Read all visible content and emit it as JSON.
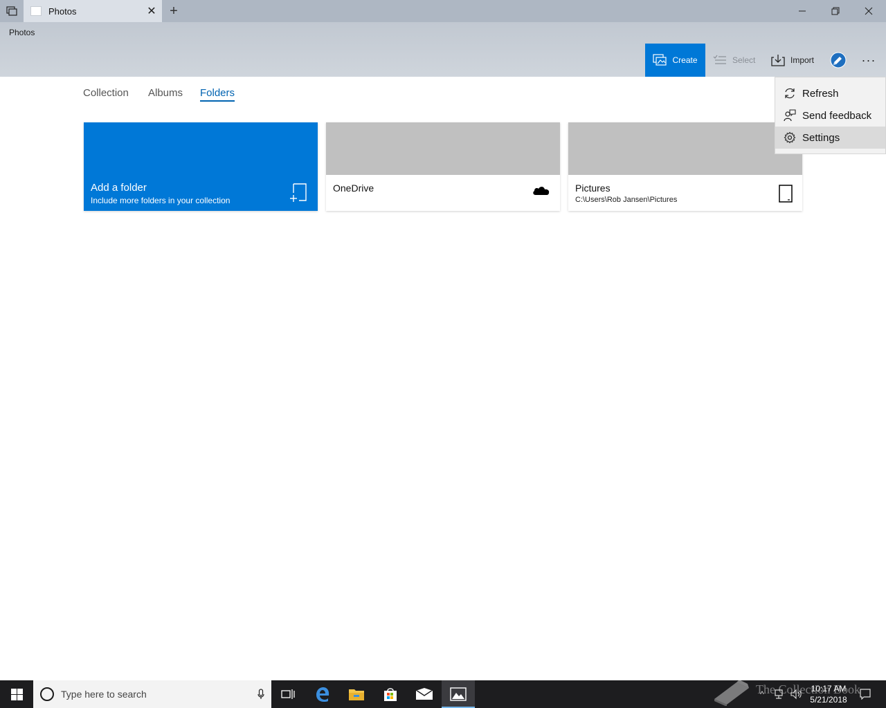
{
  "window": {
    "tab_title": "Photos",
    "app_title": "Photos"
  },
  "commands": {
    "create": "Create",
    "select": "Select",
    "import": "Import"
  },
  "pivot": {
    "items": [
      "Collection",
      "Albums",
      "Folders"
    ],
    "selected": "Folders"
  },
  "folders": {
    "add": {
      "title": "Add a folder",
      "subtitle": "Include more folders in your collection"
    },
    "onedrive": {
      "title": "OneDrive"
    },
    "pictures": {
      "title": "Pictures",
      "path": "C:\\Users\\Rob Jansen\\Pictures"
    }
  },
  "menu": {
    "items": [
      "Refresh",
      "Send feedback",
      "Settings"
    ],
    "highlighted": "Settings"
  },
  "taskbar": {
    "search_placeholder": "Type here to search",
    "time": "10:17 AM",
    "date": "5/21/2018"
  },
  "watermark": "The Collection Book",
  "colors": {
    "accent": "#0078d7",
    "link": "#0063b1",
    "header_bg": "#c1c8d1",
    "taskbar_bg": "#1d1d1f"
  },
  "icons": {
    "create": "create-slideshow-icon",
    "select": "select-list-icon",
    "import": "import-icon",
    "badge": "sketch-badge-icon",
    "add_folder": "add-folder-icon",
    "onedrive": "cloud-icon",
    "pictures": "device-icon",
    "refresh": "refresh-icon",
    "feedback": "feedback-icon",
    "settings": "gear-icon"
  }
}
